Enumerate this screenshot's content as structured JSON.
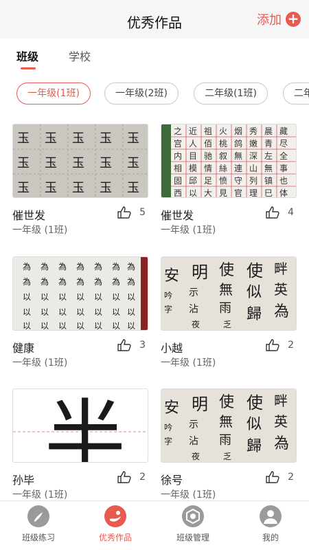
{
  "header": {
    "title": "优秀作品",
    "add_label": "添加",
    "add_icon": "plus-circle-icon"
  },
  "tabs": [
    {
      "label": "班级"
    },
    {
      "label": "学校"
    }
  ],
  "chips": [
    {
      "label": "一年级(1班)"
    },
    {
      "label": "一年级(2班)"
    },
    {
      "label": "二年级(1班)"
    },
    {
      "label": "二年"
    }
  ],
  "works": [
    {
      "name": "催世发",
      "class": "一年级 (1班)",
      "likes": "5",
      "image": "calligraphy-yu-grid"
    },
    {
      "name": "催世发",
      "class": "一年级 (1班)",
      "likes": "4",
      "image": "calligraphy-red-grid"
    },
    {
      "name": "健康",
      "class": "一年级 (1班)",
      "likes": "3",
      "image": "calligraphy-wei-yi"
    },
    {
      "name": "小越",
      "class": "一年级 (1班)",
      "likes": "2",
      "image": "calligraphy-cursive"
    },
    {
      "name": "孙毕",
      "class": "一年级 (1班)",
      "likes": "2",
      "image": "calligraphy-ban-big"
    },
    {
      "name": "徐号",
      "class": "一年级 (1班)",
      "likes": "2",
      "image": "calligraphy-cursive"
    }
  ],
  "bottom_nav": [
    {
      "label": "班级练习",
      "icon": "brush-icon"
    },
    {
      "label": "优秀作品",
      "icon": "artwork-icon"
    },
    {
      "label": "班级管理",
      "icon": "class-manage-icon"
    },
    {
      "label": "我的",
      "icon": "user-icon"
    }
  ],
  "colors": {
    "accent": "#e85a4f"
  }
}
